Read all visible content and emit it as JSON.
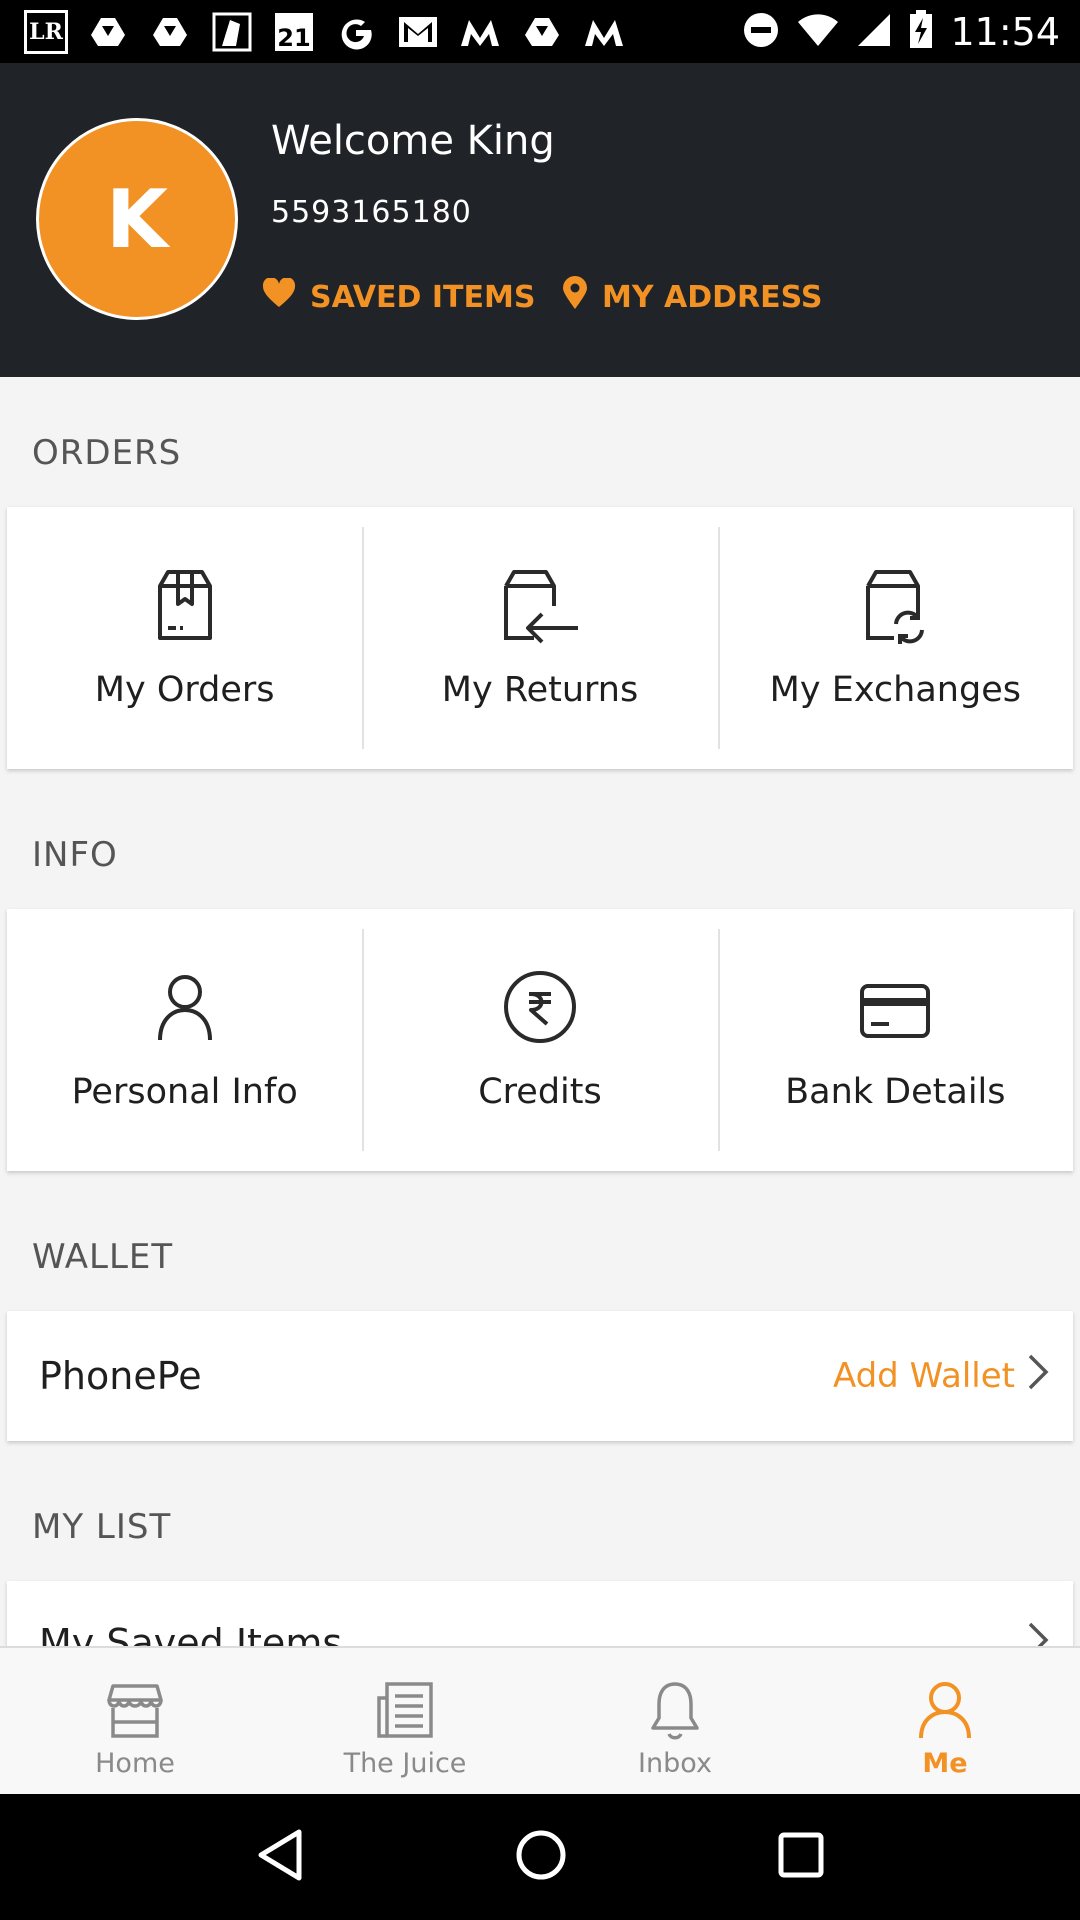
{
  "status_bar": {
    "time": "11:54",
    "left_icons": [
      "lr-app-icon",
      "drive-icon",
      "drive-icon",
      "hanuman-app-icon",
      "forever21-icon",
      "google-icon",
      "gmail-icon",
      "myntra-icon",
      "drive-icon",
      "myntra-icon"
    ],
    "lr_label": "LR",
    "f21_label": "21"
  },
  "header": {
    "avatar_letter": "K",
    "welcome": "Welcome King",
    "phone": "5593165180",
    "saved_items": "SAVED ITEMS",
    "my_address": "MY ADDRESS"
  },
  "orders": {
    "title": "ORDERS",
    "items": [
      {
        "label": "My Orders",
        "icon": "package-icon"
      },
      {
        "label": "My Returns",
        "icon": "return-box-icon"
      },
      {
        "label": "My Exchanges",
        "icon": "exchange-box-icon"
      }
    ]
  },
  "info": {
    "title": "INFO",
    "items": [
      {
        "label": "Personal Info",
        "icon": "person-icon"
      },
      {
        "label": "Credits",
        "icon": "rupee-icon"
      },
      {
        "label": "Bank Details",
        "icon": "card-icon"
      }
    ]
  },
  "wallet": {
    "title": "WALLET",
    "name": "PhonePe",
    "action": "Add Wallet"
  },
  "mylist": {
    "title": "MY LIST",
    "first_item": "My Saved Items"
  },
  "bottom_nav": [
    {
      "label": "Home",
      "icon": "store-icon"
    },
    {
      "label": "The Juice",
      "icon": "news-icon"
    },
    {
      "label": "Inbox",
      "icon": "bell-icon"
    },
    {
      "label": "Me",
      "icon": "user-icon",
      "active": true
    }
  ],
  "colors": {
    "accent": "#f29124",
    "header_bg": "#202327",
    "page_bg": "#f4f4f5"
  }
}
